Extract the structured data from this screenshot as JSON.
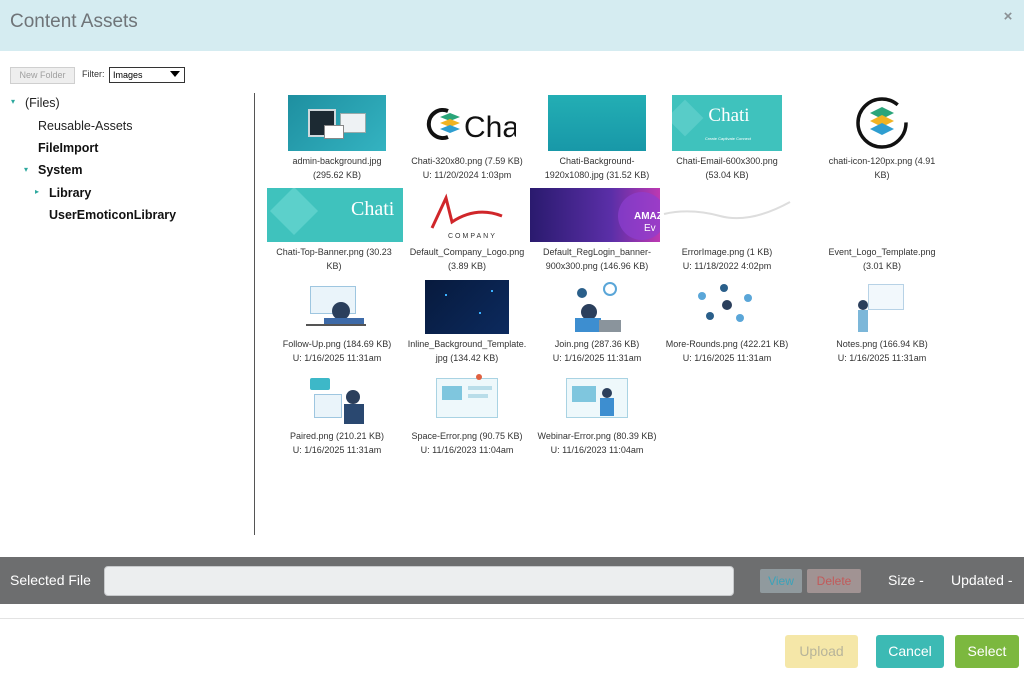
{
  "header": {
    "title": "Content Assets",
    "close": "×"
  },
  "toolbar": {
    "new_folder": "New Folder",
    "filter_label": "Filter:",
    "filter_value": "Images"
  },
  "tree": [
    {
      "label": "(Files)",
      "toggle": "▾"
    },
    {
      "label": "Reusable-Assets"
    },
    {
      "label": "FileImport"
    },
    {
      "label": "System",
      "toggle": "▾"
    },
    {
      "label": "Library",
      "toggle": "▸"
    },
    {
      "label": "UserEmoticonLibrary"
    }
  ],
  "assets": [
    {
      "lines": [
        "admin-background.jpg",
        "(295.62 KB)"
      ]
    },
    {
      "lines": [
        "Chati-320x80.png (7.59 KB)",
        "U: 11/20/2024 1:03pm"
      ],
      "thumb_text": "Cha"
    },
    {
      "lines": [
        "Chati-Background-",
        "1920x1080.jpg (31.52 KB)"
      ]
    },
    {
      "lines": [
        "Chati-Email-600x300.png",
        "(53.04 KB)"
      ],
      "thumb_text": "Chati",
      "thumb_sub": "Create Captivate Connect"
    },
    {
      "lines": [
        "chati-icon-120px.png (4.91",
        "KB)"
      ]
    },
    {
      "lines": [
        "Chati-Top-Banner.png (30.23",
        "KB)"
      ],
      "thumb_text": "Chati"
    },
    {
      "lines": [
        "Default_Company_Logo.png",
        "(3.89 KB)"
      ],
      "thumb_text": "COMPANY"
    },
    {
      "lines": [
        "Default_RegLogin_banner-",
        "900x300.png (146.96 KB)"
      ],
      "thumb_text": "AMAZ",
      "thumb_sub": "Ev"
    },
    {
      "lines": [
        "ErrorImage.png (1 KB)",
        "U: 11/18/2022 4:02pm"
      ]
    },
    {
      "lines": [
        "Event_Logo_Template.png",
        "(3.01 KB)"
      ]
    },
    {
      "lines": [
        "Follow-Up.png (184.69 KB)",
        "U: 1/16/2025 11:31am"
      ]
    },
    {
      "lines": [
        "Inline_Background_Template.",
        "jpg (134.42 KB)"
      ]
    },
    {
      "lines": [
        "Join.png (287.36 KB)",
        "U: 1/16/2025 11:31am"
      ]
    },
    {
      "lines": [
        "More-Rounds.png (422.21 KB)",
        "U: 1/16/2025 11:31am"
      ]
    },
    {
      "lines": [
        "Notes.png (166.94 KB)",
        "U: 1/16/2025 11:31am"
      ]
    },
    {
      "lines": [
        "Paired.png (210.21 KB)",
        "U: 1/16/2025 11:31am"
      ]
    },
    {
      "lines": [
        "Space-Error.png (90.75 KB)",
        "U: 11/16/2023 11:04am"
      ]
    },
    {
      "lines": [
        "Webinar-Error.png (80.39 KB)",
        "U: 11/16/2023 11:04am"
      ]
    }
  ],
  "footer": {
    "selected_label": "Selected File",
    "selected_value": "",
    "view": "View",
    "delete": "Delete",
    "size": "Size -",
    "updated": "Updated -",
    "upload": "Upload",
    "cancel": "Cancel",
    "select": "Select"
  },
  "colors": {
    "header_bg": "#d5ecf1",
    "teal": "#3cbab4",
    "green": "#7cb83f",
    "upload_disabled": "#f5e7a8"
  }
}
